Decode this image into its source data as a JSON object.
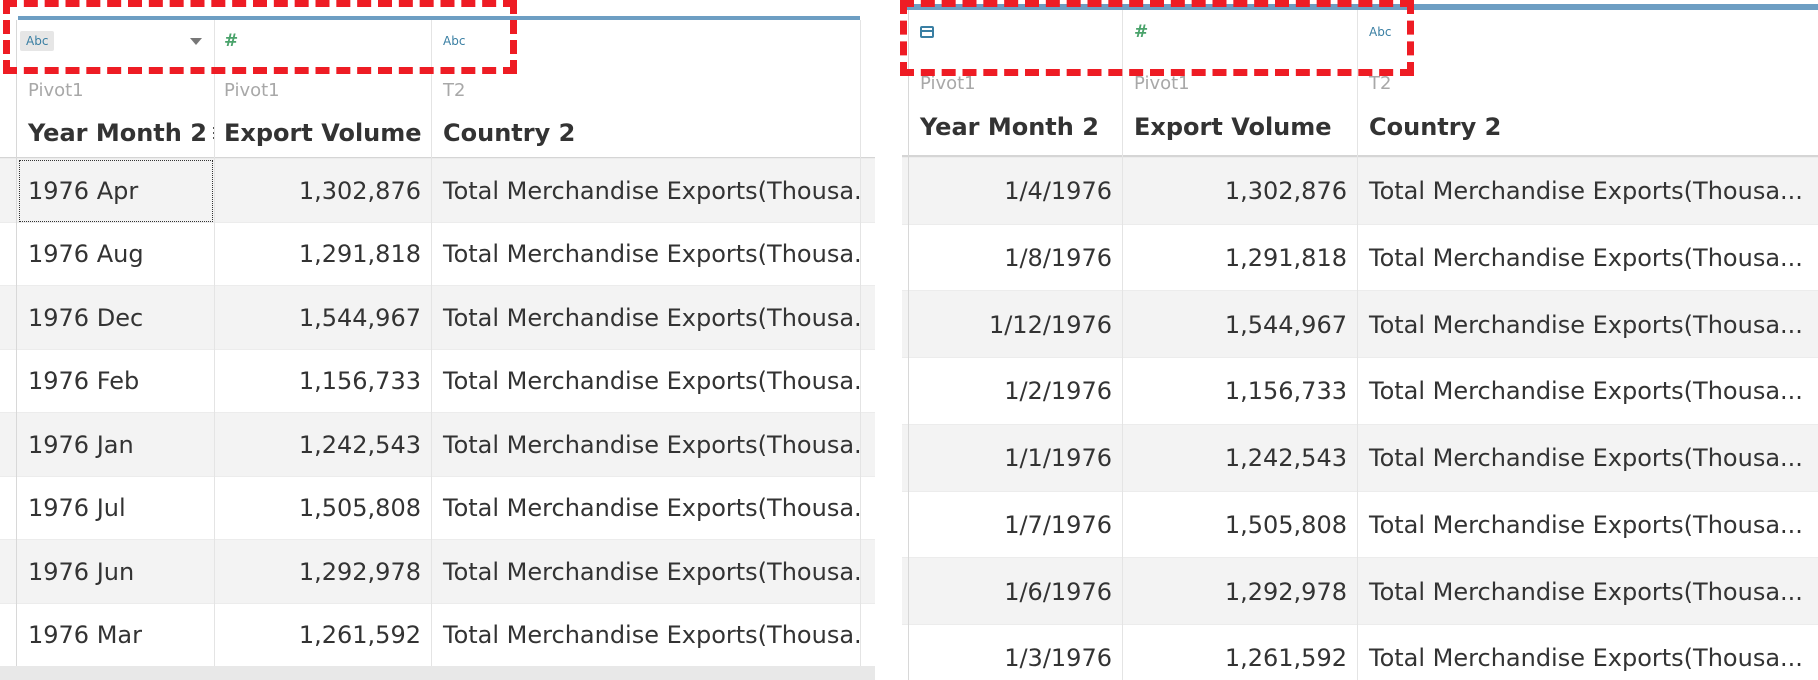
{
  "left_table": {
    "columns": [
      {
        "type_label": "Abc",
        "source": "Pivot1",
        "name": "Year Month 2"
      },
      {
        "type_label": "#",
        "source": "Pivot1",
        "name": "Export Volume"
      },
      {
        "type_label": "Abc",
        "source": "T2",
        "name": "Country 2"
      }
    ],
    "rows": [
      {
        "ym": "1976 Apr",
        "vol": "1,302,876",
        "country": "Total Merchandise Exports(Thousa..."
      },
      {
        "ym": "1976 Aug",
        "vol": "1,291,818",
        "country": "Total Merchandise Exports(Thousa..."
      },
      {
        "ym": "1976 Dec",
        "vol": "1,544,967",
        "country": "Total Merchandise Exports(Thousa..."
      },
      {
        "ym": "1976 Feb",
        "vol": "1,156,733",
        "country": "Total Merchandise Exports(Thousa..."
      },
      {
        "ym": "1976 Jan",
        "vol": "1,242,543",
        "country": "Total Merchandise Exports(Thousa..."
      },
      {
        "ym": "1976 Jul",
        "vol": "1,505,808",
        "country": "Total Merchandise Exports(Thousa..."
      },
      {
        "ym": "1976 Jun",
        "vol": "1,292,978",
        "country": "Total Merchandise Exports(Thousa..."
      },
      {
        "ym": "1976 Mar",
        "vol": "1,261,592",
        "country": "Total Merchandise Exports(Thousa..."
      }
    ]
  },
  "right_table": {
    "columns": [
      {
        "type_label": "",
        "source": "Pivot1",
        "name": "Year Month 2"
      },
      {
        "type_label": "#",
        "source": "Pivot1",
        "name": "Export Volume"
      },
      {
        "type_label": "Abc",
        "source": "T2",
        "name": "Country 2"
      }
    ],
    "rows": [
      {
        "ym": "1/4/1976",
        "vol": "1,302,876",
        "country": "Total Merchandise Exports(Thousa..."
      },
      {
        "ym": "1/8/1976",
        "vol": "1,291,818",
        "country": "Total Merchandise Exports(Thousa..."
      },
      {
        "ym": "1/12/1976",
        "vol": "1,544,967",
        "country": "Total Merchandise Exports(Thousa..."
      },
      {
        "ym": "1/2/1976",
        "vol": "1,156,733",
        "country": "Total Merchandise Exports(Thousa..."
      },
      {
        "ym": "1/1/1976",
        "vol": "1,242,543",
        "country": "Total Merchandise Exports(Thousa..."
      },
      {
        "ym": "1/7/1976",
        "vol": "1,505,808",
        "country": "Total Merchandise Exports(Thousa..."
      },
      {
        "ym": "1/6/1976",
        "vol": "1,292,978",
        "country": "Total Merchandise Exports(Thousa..."
      },
      {
        "ym": "1/3/1976",
        "vol": "1,261,592",
        "country": "Total Merchandise Exports(Thousa..."
      }
    ]
  },
  "icons": {
    "string_type": "abc-type-icon",
    "number_type": "number-type-icon",
    "date_type": "calendar-type-icon",
    "sort": "sort-icon",
    "dropdown": "chevron-down-icon"
  },
  "colors": {
    "highlight_dash": "#ee1c24",
    "header_bar": "#6d9ec3",
    "number_icon": "#4aa36b",
    "string_icon": "#3a7fa3"
  }
}
